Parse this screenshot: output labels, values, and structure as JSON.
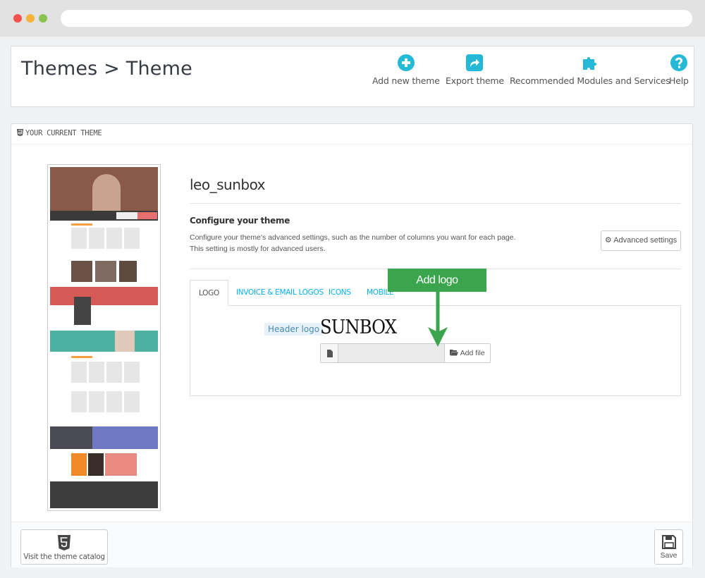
{
  "header": {
    "breadcrumb": "Themes > Theme",
    "toolbar": [
      {
        "label": "Add new theme",
        "icon": "plus-circle-icon"
      },
      {
        "label": "Export theme",
        "icon": "share-icon"
      },
      {
        "label": "Recommended Modules and Services",
        "icon": "puzzle-icon"
      },
      {
        "label": "Help",
        "icon": "help-icon"
      }
    ]
  },
  "panel": {
    "title": "YOUR CURRENT THEME",
    "theme_name": "leo_sunbox",
    "configure_title": "Configure your theme",
    "configure_desc": "Configure your theme's advanced settings, such as the number of columns you want for each page. This setting is mostly for advanced users.",
    "advanced_button": "Advanced settings",
    "tabs": [
      {
        "label": "LOGO",
        "active": true
      },
      {
        "label": "INVOICE & EMAIL LOGOS",
        "active": false
      },
      {
        "label": "ICONS",
        "active": false
      },
      {
        "label": "MOBILE",
        "active": false
      }
    ],
    "header_logo_label": "Header logo",
    "logo_text": "SUNBOX",
    "file_input_value": "",
    "add_file_button": "Add file",
    "callout": "Add logo",
    "visit_catalog_button": "Visit the theme catalog",
    "save_button": "Save"
  },
  "colors": {
    "accent": "#00aff0",
    "callout_green": "#3ba54e",
    "brand_teal": "#25b9d7"
  }
}
